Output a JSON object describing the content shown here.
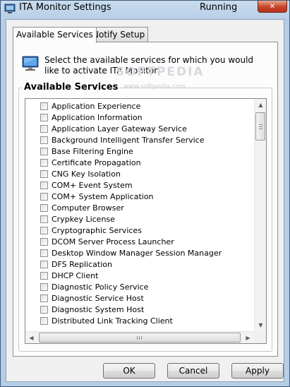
{
  "window": {
    "title": "ITA Monitor Settings",
    "status": "Running",
    "close_glyph": "✕"
  },
  "tabs": [
    {
      "label": "Available Services",
      "active": true
    },
    {
      "label": "Notify Setup",
      "active": false
    }
  ],
  "panel": {
    "description": "Select the available services for which you would like to activate ITA Monitor.",
    "watermark": "SOFTPEDIA",
    "watermark_url": "www.softpedia.com",
    "group_title": "Available Services",
    "services": [
      {
        "label": "Application Experience",
        "checked": false
      },
      {
        "label": "Application Information",
        "checked": false
      },
      {
        "label": "Application Layer Gateway Service",
        "checked": false
      },
      {
        "label": "Background Intelligent Transfer Service",
        "checked": false
      },
      {
        "label": "Base Filtering Engine",
        "checked": false
      },
      {
        "label": "Certificate Propagation",
        "checked": false
      },
      {
        "label": "CNG Key Isolation",
        "checked": false
      },
      {
        "label": "COM+ Event System",
        "checked": false
      },
      {
        "label": "COM+ System Application",
        "checked": false
      },
      {
        "label": "Computer Browser",
        "checked": false
      },
      {
        "label": "Crypkey License",
        "checked": false
      },
      {
        "label": "Cryptographic Services",
        "checked": false
      },
      {
        "label": "DCOM Server Process Launcher",
        "checked": false
      },
      {
        "label": "Desktop Window Manager Session Manager",
        "checked": false
      },
      {
        "label": "DFS Replication",
        "checked": false
      },
      {
        "label": "DHCP Client",
        "checked": false
      },
      {
        "label": "Diagnostic Policy Service",
        "checked": false
      },
      {
        "label": "Diagnostic Service Host",
        "checked": false
      },
      {
        "label": "Diagnostic System Host",
        "checked": false
      },
      {
        "label": "Distributed Link Tracking Client",
        "checked": false
      }
    ]
  },
  "buttons": {
    "ok": "OK",
    "cancel": "Cancel",
    "apply": "Apply"
  },
  "icons": {
    "app": "app-icon",
    "monitor": "monitor-icon",
    "close": "close-icon",
    "checkbox": "checkbox-icon",
    "scroll_up": "arrow-up-icon",
    "scroll_down": "arrow-down-icon",
    "scroll_left": "arrow-left-icon",
    "scroll_right": "arrow-right-icon"
  },
  "colors": {
    "titlebar": "#b6cde6",
    "close_button": "#c8442a",
    "panel_background": "#fcfcfc"
  }
}
